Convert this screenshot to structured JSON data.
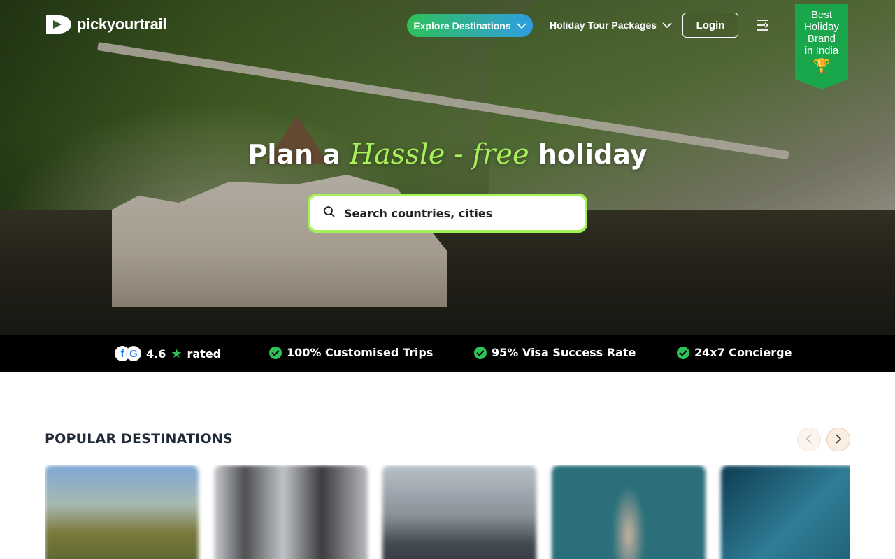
{
  "brand": {
    "name": "pickyourtrail"
  },
  "nav": {
    "explore_label": "Explore Destinations",
    "packages_label": "Holiday Tour Packages",
    "login_label": "Login"
  },
  "badge": {
    "line1": "Best",
    "line2": "Holiday",
    "line3": "Brand",
    "line4": "in India"
  },
  "hero": {
    "title_prefix": "Plan a",
    "title_script": "Hassle - free",
    "title_suffix": "holiday",
    "search_placeholder": "Search countries, cities"
  },
  "trust": {
    "rating": "4.6",
    "rated_label": "rated",
    "items": [
      "100% Customised Trips",
      "95% Visa Success Rate",
      "24x7 Concierge"
    ]
  },
  "popular": {
    "title": "POPULAR DESTINATIONS"
  },
  "colors": {
    "accent_green": "#2fc05a",
    "search_border": "#a3f255",
    "script_text": "#a9f15b",
    "badge_green": "#1aa64a"
  }
}
